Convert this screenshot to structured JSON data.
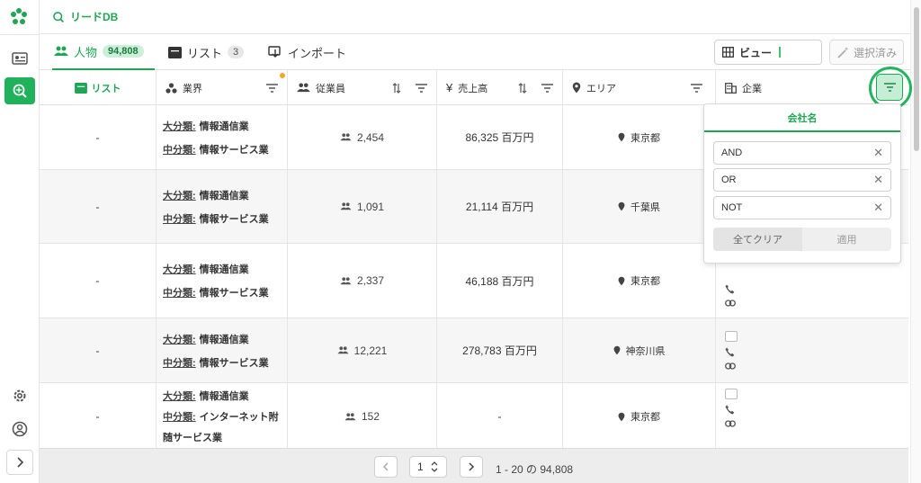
{
  "app": {
    "title": "リードDB"
  },
  "colors": {
    "accent": "#1fa653",
    "accent_bg": "#c6eed6",
    "badge_dot": "#f5a623"
  },
  "tabs": [
    {
      "label": "人物",
      "count": "94,808",
      "active": true,
      "icon": "people-icon"
    },
    {
      "label": "リスト",
      "count": "3",
      "active": false,
      "icon": "list-icon"
    },
    {
      "label": "インポート",
      "active": false,
      "icon": "import-icon"
    }
  ],
  "toolbar": {
    "view_label": "ビュー",
    "selected_label": "選択済み"
  },
  "columns": {
    "list": "リスト",
    "industry": "業界",
    "employees": "従業員",
    "sales": "売上高",
    "area": "エリア",
    "company": "企業"
  },
  "labels": {
    "major": "大分類:",
    "minor": "中分類:"
  },
  "rows": [
    {
      "list": "-",
      "major": "情報通信業",
      "minor": "情報サービス業",
      "employees": "2,454",
      "sales": "86,325 百万円",
      "area": "東京都"
    },
    {
      "list": "-",
      "major": "情報通信業",
      "minor": "情報サービス業",
      "employees": "1,091",
      "sales": "21,114 百万円",
      "area": "千葉県"
    },
    {
      "list": "-",
      "major": "情報通信業",
      "minor": "情報サービス業",
      "employees": "2,337",
      "sales": "46,188 百万円",
      "area": "東京都"
    },
    {
      "list": "-",
      "major": "情報通信業",
      "minor": "情報サービス業",
      "employees": "12,221",
      "sales": "278,783 百万円",
      "area": "神奈川県"
    },
    {
      "list": "-",
      "major": "情報通信業",
      "minor": "インターネット附",
      "minor2": "随サービス業",
      "employees": "152",
      "sales": "-",
      "area": "東京都"
    }
  ],
  "filter_popup": {
    "title": "会社名",
    "inputs": [
      "AND",
      "OR",
      "NOT"
    ],
    "clear_label": "全てクリア",
    "apply_label": "適用"
  },
  "pagination": {
    "page": "1",
    "info": "1 - 20 の 94,808"
  }
}
